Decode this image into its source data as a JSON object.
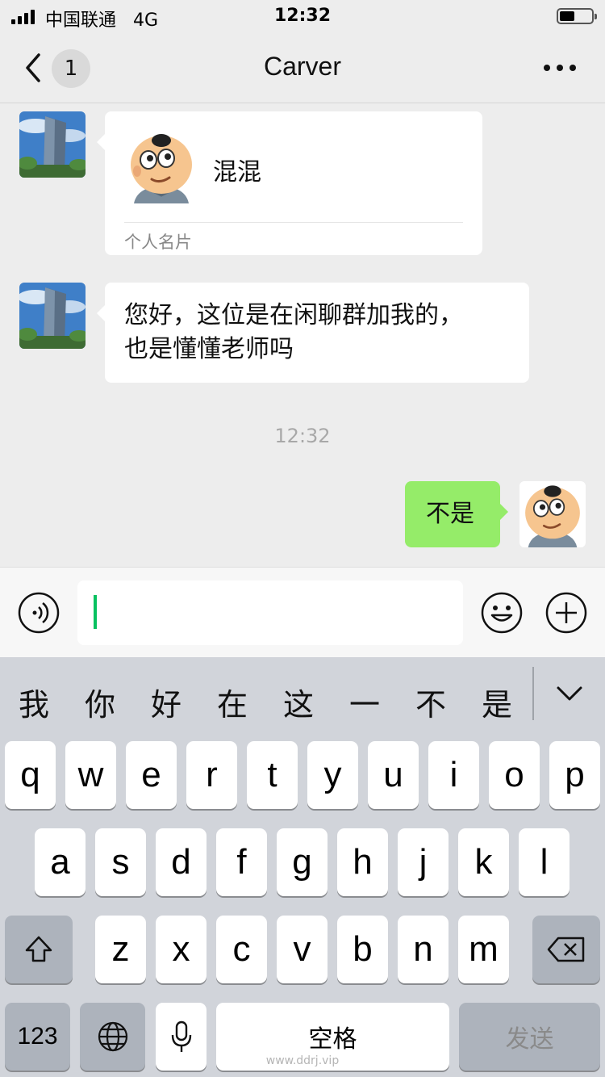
{
  "status_bar": {
    "carrier": "中国联通",
    "network": "4G",
    "time": "12:32"
  },
  "nav": {
    "unread_count": "1",
    "title": "Carver"
  },
  "messages": {
    "card": {
      "name": "混混",
      "label": "个人名片"
    },
    "text_in": {
      "line1": "您好，这位是在闲聊群加我的，",
      "line2": "也是懂懂老师吗"
    },
    "timestamp": "12:32",
    "text_out": "不是"
  },
  "keyboard": {
    "candidates": [
      "我",
      "你",
      "好",
      "在",
      "这",
      "一",
      "不",
      "是"
    ],
    "row1": [
      "q",
      "w",
      "e",
      "r",
      "t",
      "y",
      "u",
      "i",
      "o",
      "p"
    ],
    "row2": [
      "a",
      "s",
      "d",
      "f",
      "g",
      "h",
      "j",
      "k",
      "l"
    ],
    "row3": [
      "z",
      "x",
      "c",
      "v",
      "b",
      "n",
      "m"
    ],
    "numbers_key": "123",
    "space_key": "空格",
    "send_key": "发送"
  },
  "watermark": "www.ddrj.vip"
}
